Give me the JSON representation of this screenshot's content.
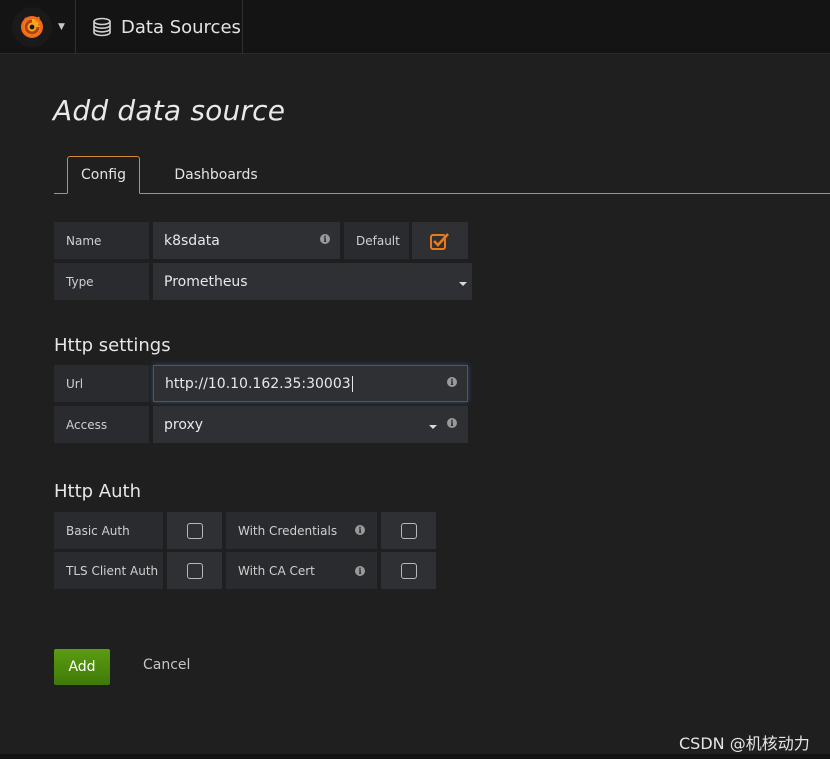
{
  "header": {
    "breadcrumb_title": "Data Sources"
  },
  "page": {
    "title": "Add data source"
  },
  "tabs": [
    {
      "label": "Config",
      "active": true
    },
    {
      "label": "Dashboards",
      "active": false
    }
  ],
  "general": {
    "name_label": "Name",
    "name_value": "k8sdata",
    "default_label": "Default",
    "default_checked": true,
    "type_label": "Type",
    "type_value": "Prometheus"
  },
  "http_settings": {
    "heading": "Http settings",
    "url_label": "Url",
    "url_value": "http://10.10.162.35:30003",
    "access_label": "Access",
    "access_value": "proxy"
  },
  "http_auth": {
    "heading": "Http Auth",
    "basic_auth_label": "Basic Auth",
    "basic_auth_checked": false,
    "with_credentials_label": "With Credentials",
    "with_credentials_checked": false,
    "tls_client_auth_label": "TLS Client Auth",
    "tls_client_auth_checked": false,
    "with_ca_cert_label": "With CA Cert",
    "with_ca_cert_checked": false
  },
  "actions": {
    "add_label": "Add",
    "cancel_label": "Cancel"
  },
  "watermark": "CSDN @机核动力",
  "colors": {
    "accent": "#d28a34",
    "checkbox_checked": "#eb7b18",
    "add_button": "#4f8a0f",
    "background": "#1f1f20",
    "input": "#2f3034",
    "label": "#2a2b2e"
  }
}
